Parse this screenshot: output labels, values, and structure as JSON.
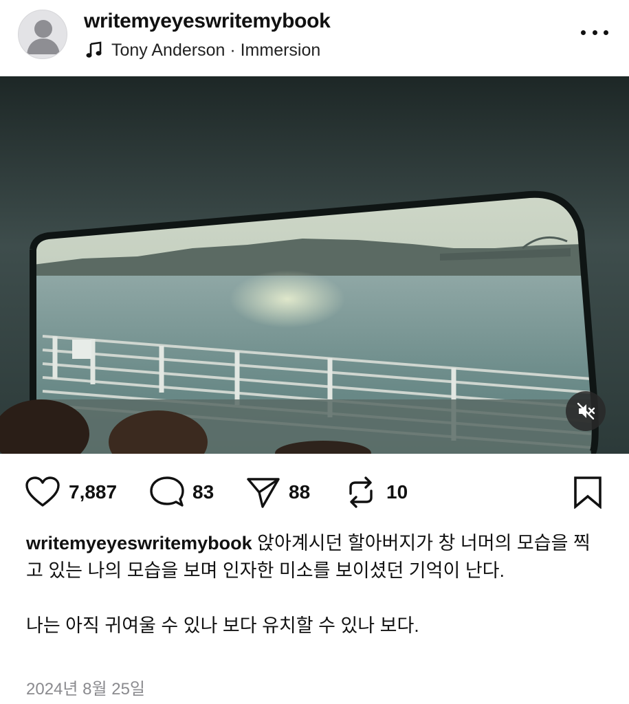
{
  "header": {
    "username": "writemyeyeswritemybook",
    "music_icon": "music-note-icon",
    "music_text": "Tony Anderson · Immersion",
    "more_icon": "more-horizontal-icon"
  },
  "media": {
    "type": "video",
    "mute_icon": "speaker-muted-icon"
  },
  "actions": {
    "likes": "7,887",
    "comments": "83",
    "shares": "88",
    "reposts": "10",
    "icons": [
      "heart-icon",
      "comment-icon",
      "send-icon",
      "repost-icon",
      "bookmark-icon"
    ]
  },
  "caption": {
    "username": "writemyeyeswritemybook",
    "text_line1": "앉아계시던 할아버지가 창 너머의 모습을 찍고 있는 나의 모습을 보며 인자한 미소를 보이셨던 기억이 난다.",
    "text_line2": "나는 아직 귀여울 수 있나 보다 유치할 수 있나 보다."
  },
  "date": "2024년 8월 25일"
}
